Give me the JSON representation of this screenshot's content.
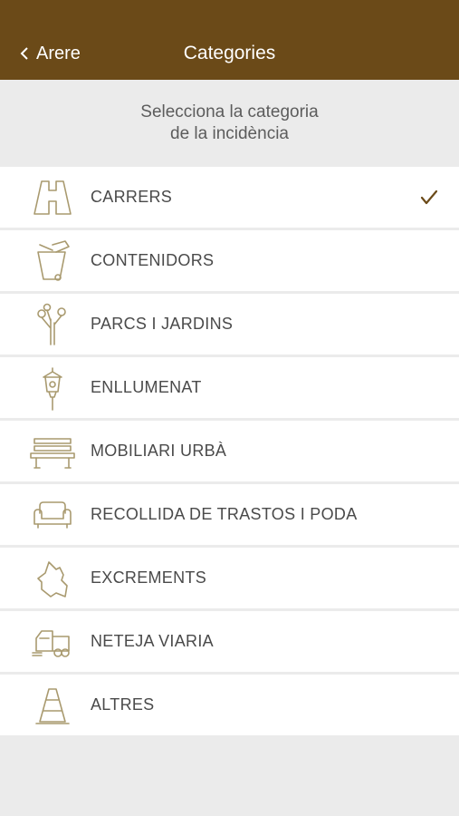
{
  "navbar": {
    "back_label": "Arere",
    "title": "Categories"
  },
  "header": {
    "line1": "Selecciona la categoria",
    "line2": "de la incidència"
  },
  "categories": [
    {
      "label": "CARRERS",
      "icon": "road-icon",
      "selected": true
    },
    {
      "label": "CONTENIDORS",
      "icon": "trash-bin-icon",
      "selected": false
    },
    {
      "label": "PARCS I JARDINS",
      "icon": "tree-icon",
      "selected": false
    },
    {
      "label": "ENLLUMENAT",
      "icon": "street-lamp-icon",
      "selected": false
    },
    {
      "label": "MOBILIARI URBÀ",
      "icon": "bench-icon",
      "selected": false
    },
    {
      "label": "RECOLLIDA DE TRASTOS I PODA",
      "icon": "sofa-icon",
      "selected": false
    },
    {
      "label": "EXCREMENTS",
      "icon": "dog-icon",
      "selected": false
    },
    {
      "label": "NETEJA VIARIA",
      "icon": "sweeper-truck-icon",
      "selected": false
    },
    {
      "label": "ALTRES",
      "icon": "traffic-cone-icon",
      "selected": false
    }
  ],
  "colors": {
    "navbar": "#6b4a18",
    "icon": "#a99a6f",
    "checkmark": "#6b4a18",
    "background": "#ebebeb"
  }
}
